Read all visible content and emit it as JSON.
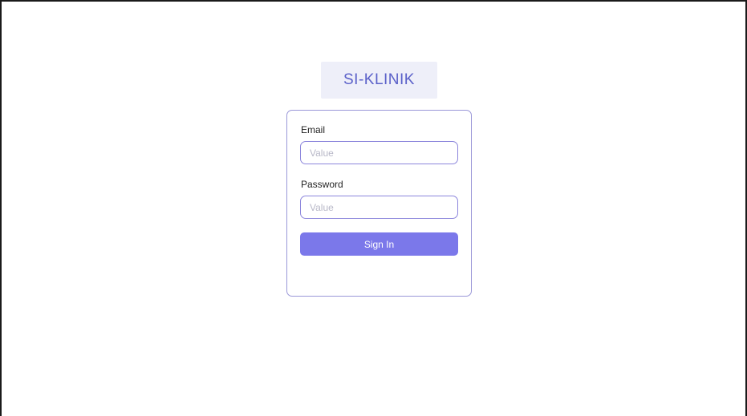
{
  "app": {
    "brand": "SI-KLINIK"
  },
  "login_form": {
    "email_label": "Email",
    "email_placeholder": "Value",
    "email_value": "",
    "password_label": "Password",
    "password_placeholder": "Value",
    "password_value": "",
    "submit_label": "Sign In"
  },
  "colors": {
    "accent": "#7b78ea",
    "brand_text": "#5b61c9",
    "brand_background": "#eeeff9",
    "card_border": "#9a97d8"
  }
}
